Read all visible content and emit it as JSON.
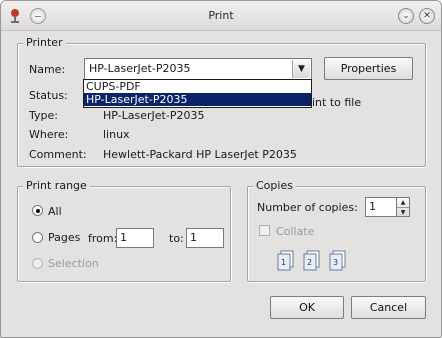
{
  "window": {
    "title": "Print"
  },
  "printer": {
    "group_title": "Printer",
    "name_label": "Name:",
    "name_value": "HP-LaserJet-P2035",
    "properties_label": "Properties",
    "options": [
      {
        "label": "CUPS-PDF"
      },
      {
        "label": "HP-LaserJet-P2035"
      }
    ],
    "status_label": "Status:",
    "print_to_file_partial": "int to file",
    "type_label": "Type:",
    "type_value": "HP-LaserJet-P2035",
    "where_label": "Where:",
    "where_value": "linux",
    "comment_label": "Comment:",
    "comment_value": "Hewlett-Packard HP LaserJet P2035"
  },
  "print_range": {
    "group_title": "Print range",
    "all_label": "All",
    "pages_label": "Pages",
    "from_label": "from:",
    "from_value": "1",
    "to_label": "to:",
    "to_value": "1",
    "selection_label": "Selection"
  },
  "copies": {
    "group_title": "Copies",
    "number_label": "Number of copies:",
    "number_value": "1",
    "collate_label": "Collate"
  },
  "buttons": {
    "ok": "OK",
    "cancel": "Cancel"
  },
  "colors": {
    "selection": "#0a246a",
    "window_bg": "#e4e2e0"
  },
  "icons": [
    "printer-app-icon",
    "minimize-icon",
    "chevron-down-icon",
    "close-icon",
    "collate-page-icon"
  ]
}
